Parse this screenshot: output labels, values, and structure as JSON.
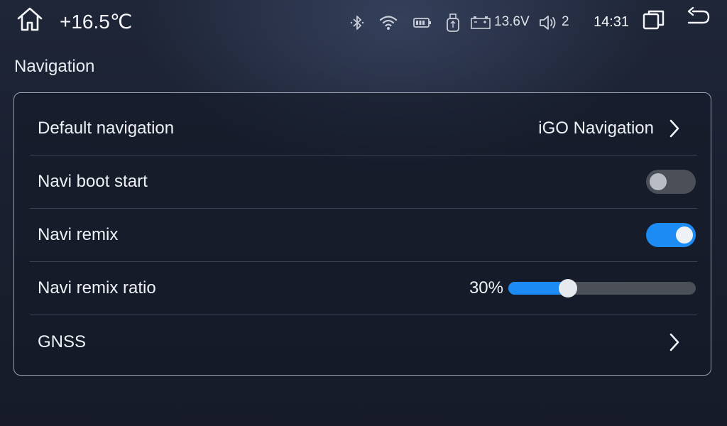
{
  "status_bar": {
    "temperature": "+16.5℃",
    "voltage": "13.6V",
    "volume": "2",
    "time": "14:31",
    "icons": [
      "home-icon",
      "bluetooth-icon",
      "wifi-icon",
      "battery-icon",
      "usb-icon",
      "car-battery-icon",
      "volume-icon",
      "window-icon",
      "back-icon"
    ]
  },
  "section": {
    "title": "Navigation"
  },
  "settings": {
    "default_navigation": {
      "label": "Default navigation",
      "value": "iGO Navigation"
    },
    "navi_boot_start": {
      "label": "Navi boot start",
      "enabled": false
    },
    "navi_remix": {
      "label": "Navi remix",
      "enabled": true
    },
    "navi_remix_ratio": {
      "label": "Navi remix ratio",
      "value_text": "30%",
      "value": 0.32
    },
    "gnss": {
      "label": "GNSS"
    }
  },
  "colors": {
    "accent": "#1c8bf4",
    "toggle_off": "#4a4f58",
    "background": "#1a2030"
  }
}
